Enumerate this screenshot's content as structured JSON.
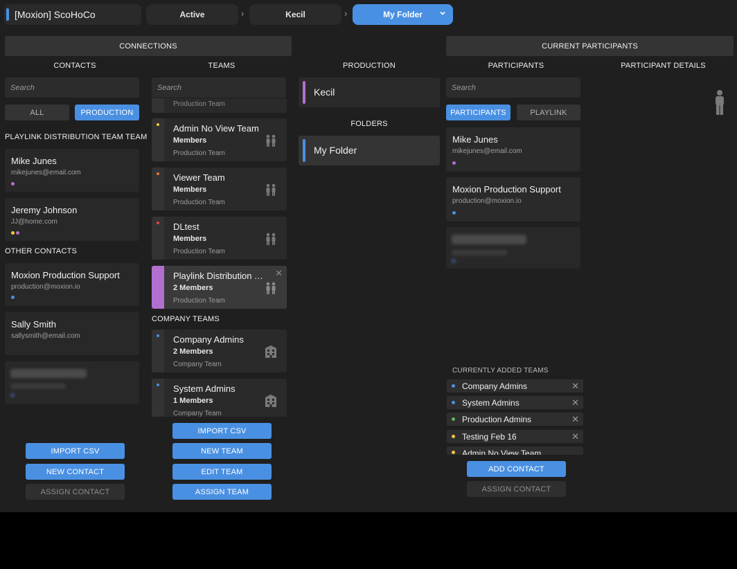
{
  "header": {
    "app_title": "[Moxion] ScoHoCo",
    "breadcrumbs": [
      "Active",
      "Kecil",
      "My Folder"
    ],
    "chevron": "›",
    "dropdown_icon": "⌄"
  },
  "connections": {
    "title": "CONNECTIONS",
    "contacts_label": "CONTACTS",
    "teams_label": "TEAMS",
    "contacts_search_placeholder": "Search",
    "teams_search_placeholder": "Search",
    "filter_all": "ALL",
    "filter_production": "PRODUCTION",
    "group_playlink": "PLAYLINK DISTRIBUTION TEAM TEAM",
    "group_other": "OTHER CONTACTS",
    "contacts_playlink": [
      {
        "name": "Mike Junes",
        "email": "mikejunes@email.com",
        "dots": [
          "#b36fd0"
        ]
      },
      {
        "name": "Jeremy Johnson",
        "email": "JJ@home.com",
        "dots": [
          "#f5c542",
          "#b36fd0"
        ]
      }
    ],
    "contacts_other": [
      {
        "name": "Moxion Production Support",
        "email": "production@moxion.io",
        "dots": [
          "#4a90e2"
        ]
      },
      {
        "name": "Sally Smith",
        "email": "sallysmith@email.com",
        "dots": []
      }
    ],
    "team_partial_type": "Production Team",
    "teams_production": [
      {
        "name": "Admin No View Team",
        "members": "Members",
        "type": "Production Team",
        "dot": "#f5c542",
        "selected": false
      },
      {
        "name": "Viewer Team",
        "members": "Members",
        "type": "Production Team",
        "dot": "#e8743b",
        "selected": false
      },
      {
        "name": "DLtest",
        "members": "Members",
        "type": "Production Team",
        "dot": "#e04848",
        "selected": false
      },
      {
        "name": "Playlink Distribution Team",
        "members": "2 Members",
        "type": "Production Team",
        "dot": null,
        "selected": true
      }
    ],
    "company_teams_label": "COMPANY TEAMS",
    "teams_company": [
      {
        "name": "Company Admins",
        "members": "2 Members",
        "type": "Company Team",
        "dot": "#4a90e2"
      },
      {
        "name": "System Admins",
        "members": "1 Members",
        "type": "Company Team",
        "dot": "#4a90e2"
      }
    ],
    "contact_buttons": {
      "import": "IMPORT CSV",
      "new": "NEW CONTACT",
      "assign": "ASSIGN CONTACT"
    },
    "team_buttons": {
      "import": "IMPORT CSV",
      "new": "NEW TEAM",
      "edit": "EDIT TEAM",
      "assign": "ASSIGN TEAM"
    }
  },
  "production": {
    "label": "PRODUCTION",
    "item": {
      "label": "Kecil",
      "color": "#b36fd0"
    },
    "folders_label": "FOLDERS",
    "folder": {
      "label": "My Folder",
      "color": "#4a90e2"
    }
  },
  "participants": {
    "title": "CURRENT PARTICIPANTS",
    "participants_label": "PARTICIPANTS",
    "details_label": "PARTICIPANT DETAILS",
    "search_placeholder": "Search",
    "tab_participants": "PARTICIPANTS",
    "tab_playlink": "PLAYLINK",
    "list": [
      {
        "name": "Mike Junes",
        "email": "mikejunes@email.com",
        "dot": "#b36fd0"
      },
      {
        "name": "Moxion Production Support",
        "email": "production@moxion.io",
        "dot": "#4a90e2"
      }
    ],
    "added_teams_label": "CURRENTLY ADDED TEAMS",
    "added_teams": [
      {
        "name": "Company Admins",
        "dot": "#4a90e2"
      },
      {
        "name": "System Admins",
        "dot": "#4a90e2"
      },
      {
        "name": "Production Admins",
        "dot": "#5cb85c"
      },
      {
        "name": "Testing Feb 16",
        "dot": "#f5c542"
      },
      {
        "name": "Admin No View Team",
        "dot": "#f5c542"
      }
    ],
    "remove_icon": "✕",
    "add_contact": "ADD CONTACT",
    "assign_contact": "ASSIGN CONTACT"
  }
}
